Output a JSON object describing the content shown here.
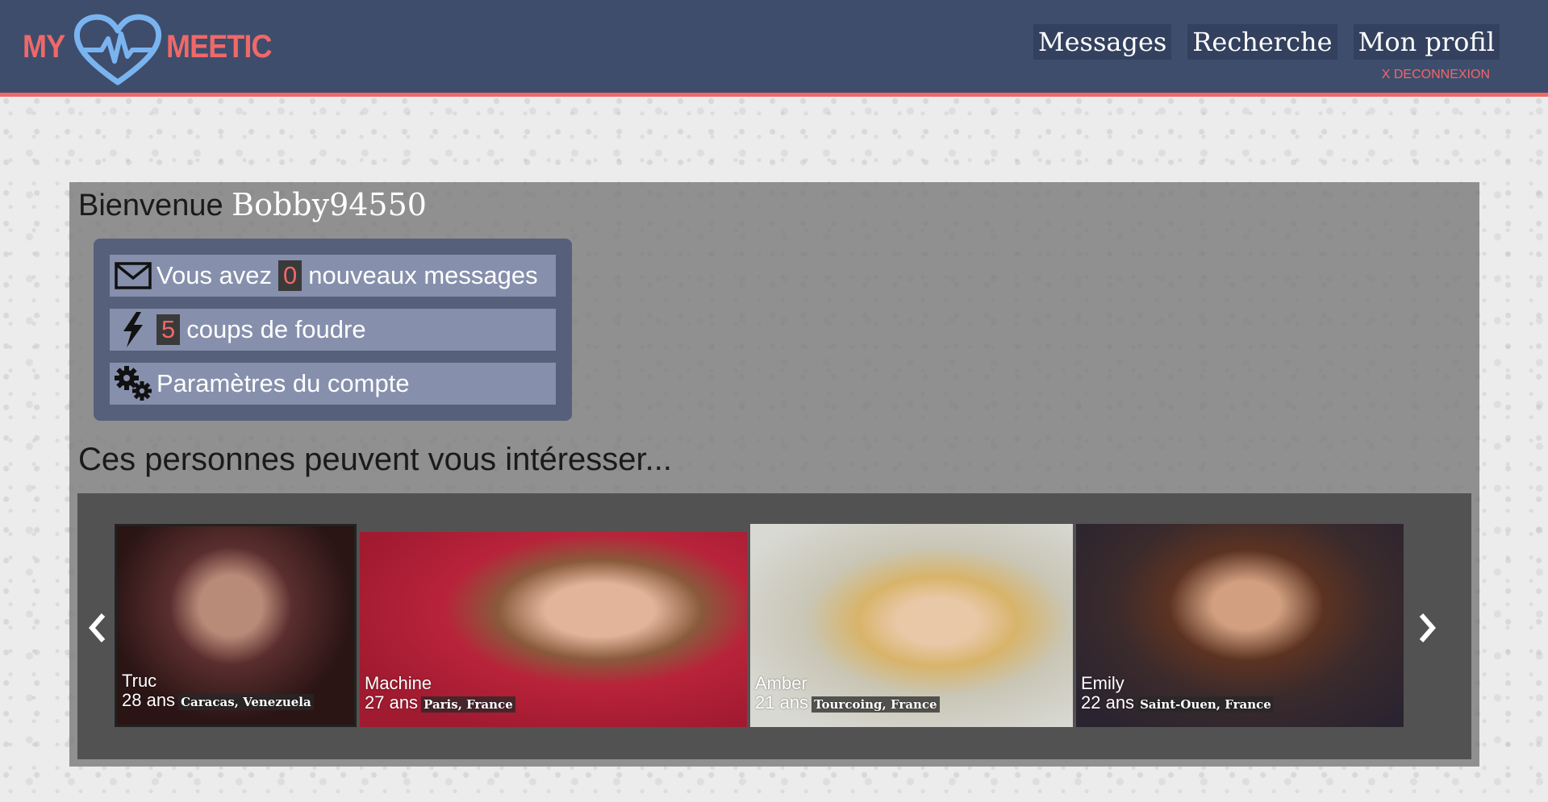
{
  "header": {
    "logo_left": "MY",
    "logo_right": "MEETIC",
    "nav": [
      "Messages",
      "Recherche",
      "Mon profil"
    ],
    "logout": "X DECONNEXION"
  },
  "welcome": {
    "prefix": "Bienvenue",
    "username": "Bobby94550"
  },
  "summary": {
    "messages_prefix": "Vous avez",
    "messages_count": "0",
    "messages_suffix": "nouveaux messages",
    "crushes_count": "5",
    "crushes_label": "coups de foudre",
    "settings_label": "Paramètres du compte"
  },
  "suggestions": {
    "title": "Ces personnes peuvent vous intéresser...",
    "profiles": [
      {
        "name": "Truc",
        "age": "28 ans",
        "location": "Caracas, Venezuela"
      },
      {
        "name": "Machine",
        "age": "27 ans",
        "location": "Paris, France"
      },
      {
        "name": "Amber",
        "age": "21 ans",
        "location": "Tourcoing, France"
      },
      {
        "name": "Emily",
        "age": "22 ans",
        "location": "Saint-Ouen, France"
      }
    ]
  },
  "colors": {
    "header_bg": "#3e4d6c",
    "accent": "#f06868",
    "logo_heart": "#7ab4f0"
  },
  "icons": {
    "messages": "envelope-icon",
    "crushes": "lightning-icon",
    "settings": "gears-icon",
    "prev": "chevron-left-icon",
    "next": "chevron-right-icon"
  }
}
